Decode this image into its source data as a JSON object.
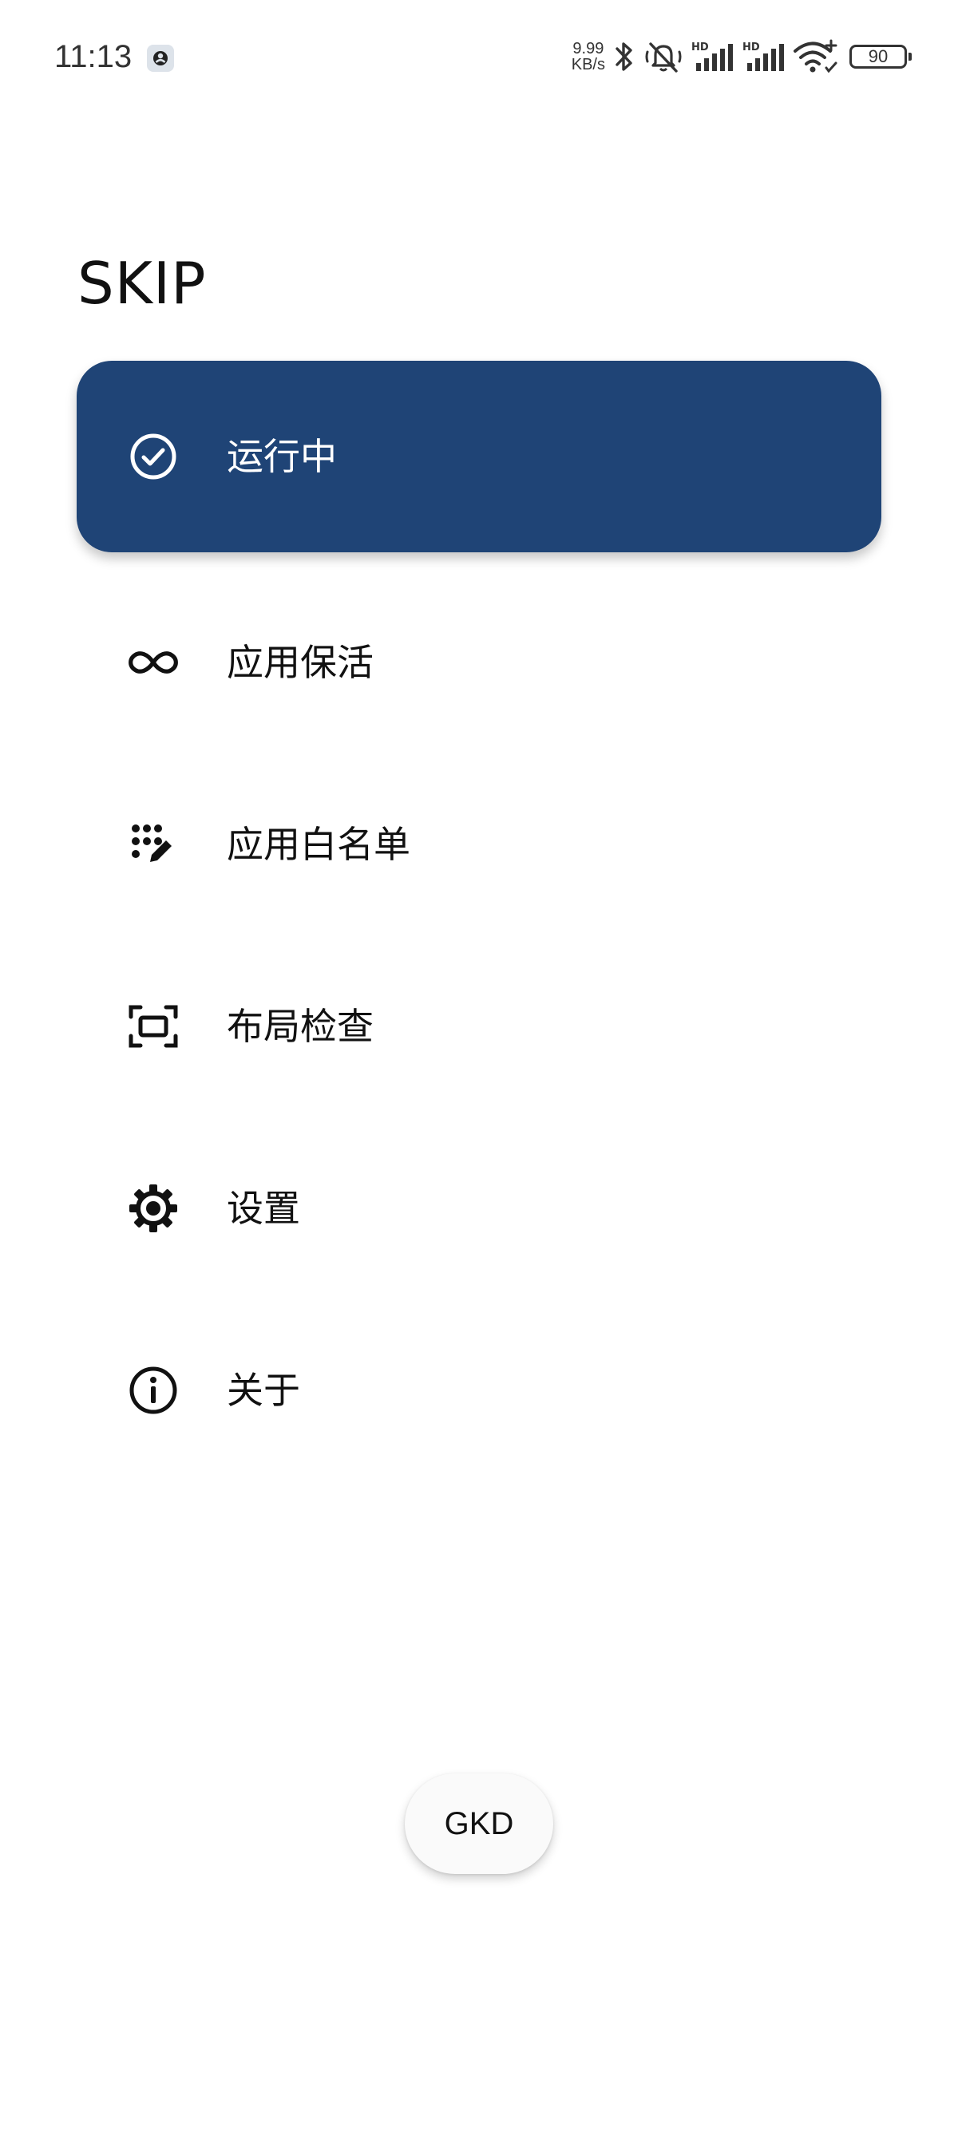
{
  "status_bar": {
    "time": "11:13",
    "net_speed_value": "9.99",
    "net_speed_unit": "KB/s",
    "battery_level": "90",
    "icons": [
      "notification-icon",
      "bluetooth-icon",
      "mute-icon",
      "hd-signal-icon",
      "hd-signal-icon",
      "wifi-icon",
      "battery-icon"
    ]
  },
  "app": {
    "title": "SKIP"
  },
  "nav": {
    "items": [
      {
        "label": "运行中",
        "icon": "check-circle-icon",
        "active": true
      },
      {
        "label": "应用保活",
        "icon": "infinity-icon",
        "active": false
      },
      {
        "label": "应用白名单",
        "icon": "dots-edit-icon",
        "active": false
      },
      {
        "label": "布局检查",
        "icon": "frame-inspect-icon",
        "active": false
      },
      {
        "label": "设置",
        "icon": "gear-icon",
        "active": false
      },
      {
        "label": "关于",
        "icon": "info-icon",
        "active": false
      }
    ]
  },
  "chip": {
    "label": "GKD"
  },
  "colors": {
    "accent": "#1f4476",
    "background": "#ffffff",
    "text": "#111111",
    "active_text": "#ffffff"
  }
}
